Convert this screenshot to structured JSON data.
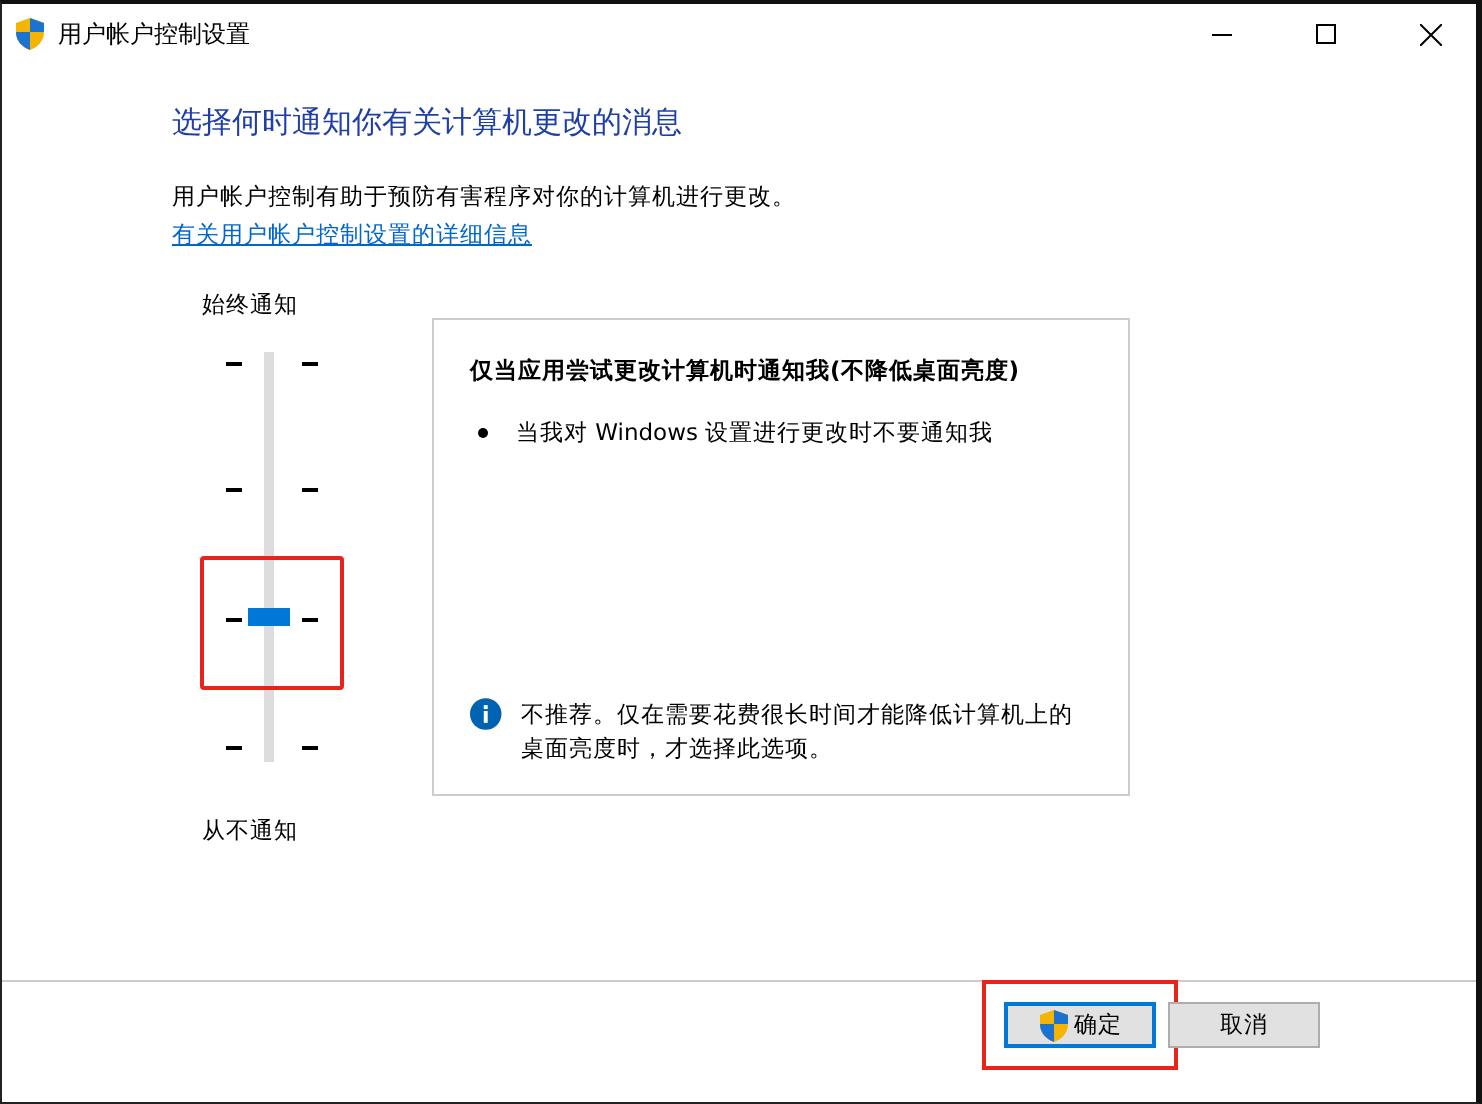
{
  "window": {
    "title": "用户帐户控制设置"
  },
  "heading": "选择何时通知你有关计算机更改的消息",
  "description": "用户帐户控制有助于预防有害程序对你的计算机进行更改。",
  "link": "有关用户帐户控制设置的详细信息",
  "slider": {
    "top_label": "始终通知",
    "bottom_label": "从不通知",
    "level": 0.3333,
    "highlighted": true
  },
  "info_box": {
    "title": "仅当应用尝试更改计算机时通知我(不降低桌面亮度)",
    "bullets": [
      "当我对 Windows 设置进行更改时不要通知我"
    ],
    "note": "不推荐。仅在需要花费很长时间才能降低计算机上的桌面亮度时，才选择此选项。"
  },
  "buttons": [
    {
      "label": "确定",
      "kind": "shield",
      "highlighted": true
    },
    {
      "label": "取消",
      "kind": "plain",
      "highlighted": false
    }
  ]
}
